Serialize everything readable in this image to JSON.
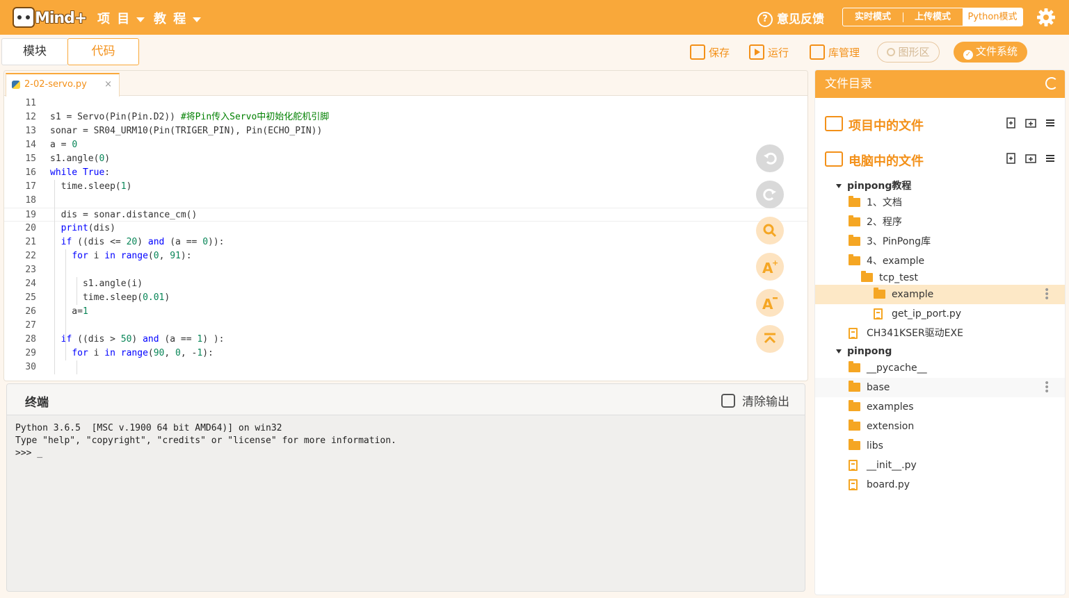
{
  "app": {
    "logo_text": "Mind+",
    "menu_project": "项 目",
    "menu_tutorial": "教 程",
    "feedback": "意见反馈",
    "modes": [
      "实时模式",
      "上传模式",
      "Python模式"
    ]
  },
  "subbar": {
    "tab_blocks": "模块",
    "tab_code": "代码",
    "save": "保存",
    "run": "运行",
    "library": "库管理",
    "graphics": "图形区",
    "filesystem": "文件系统"
  },
  "editor": {
    "file_tab": "2-02-servo.py",
    "close": "×"
  },
  "code_lines": [
    {
      "n": "11",
      "html": ""
    },
    {
      "n": "12",
      "html": "s1 = Servo(Pin(Pin.D2)) <span class='cm'>#将Pin传入Servo中初始化舵机引脚</span>"
    },
    {
      "n": "13",
      "html": "sonar = SR04_URM10(Pin(TRIGER_PIN), Pin(ECHO_PIN))"
    },
    {
      "n": "14",
      "html": "a = <span class='num'>0</span>"
    },
    {
      "n": "15",
      "html": "s1.angle(<span class='num'>0</span>)"
    },
    {
      "n": "16",
      "html": "<span class='kw'>while</span> <span class='kw'>True</span>:"
    },
    {
      "n": "17",
      "html": "  time.sleep(<span class='num'>1</span>)"
    },
    {
      "n": "18",
      "html": ""
    },
    {
      "n": "19",
      "html": "  dis = sonar.distance_cm()"
    },
    {
      "n": "20",
      "html": "  <span class='kw'>print</span>(dis)"
    },
    {
      "n": "21",
      "html": "  <span class='kw'>if</span> ((dis &lt;= <span class='num'>20</span>) <span class='kw'>and</span> (a == <span class='num'>0</span>)):"
    },
    {
      "n": "22",
      "html": "    <span class='kw'>for</span> i <span class='kw'>in</span> <span class='kw'>range</span>(<span class='num'>0</span>, <span class='num'>91</span>):"
    },
    {
      "n": "23",
      "html": ""
    },
    {
      "n": "24",
      "html": "      s1.angle(i)"
    },
    {
      "n": "25",
      "html": "      time.sleep(<span class='num'>0.01</span>)"
    },
    {
      "n": "26",
      "html": "    a=<span class='num'>1</span>"
    },
    {
      "n": "27",
      "html": ""
    },
    {
      "n": "28",
      "html": "  <span class='kw'>if</span> ((dis &gt; <span class='num'>50</span>) <span class='kw'>and</span> (a == <span class='num'>1</span>) ):"
    },
    {
      "n": "29",
      "html": "    <span class='kw'>for</span> i <span class='kw'>in</span> <span class='kw'>range</span>(<span class='num'>90</span>, <span class='num'>0</span>, -<span class='num'>1</span>):"
    },
    {
      "n": "30",
      "html": ""
    }
  ],
  "terminal": {
    "title": "终端",
    "clear": "清除输出",
    "output": "Python 3.6.5  [MSC v.1900 64 bit AMD64)] on win32\nType \"help\", \"copyright\", \"credits\" or \"license\" for more information.\n>>> _"
  },
  "files": {
    "header": "文件目录",
    "project_files": "项目中的文件",
    "pc_files": "电脑中的文件",
    "tree": [
      {
        "label": "pinpong教程",
        "type": "root"
      },
      {
        "label": "1、文档",
        "type": "folder"
      },
      {
        "label": "2、程序",
        "type": "folder"
      },
      {
        "label": "3、PinPong库",
        "type": "folder"
      },
      {
        "label": "4、example",
        "type": "folder-open"
      },
      {
        "label": "tcp_test",
        "type": "folder-open"
      },
      {
        "label": "example",
        "type": "folder"
      },
      {
        "label": "get_ip_port.py",
        "type": "file"
      },
      {
        "label": "CH341KSER驱动EXE",
        "type": "file"
      },
      {
        "label": "pinpong",
        "type": "root"
      },
      {
        "label": "__pycache__",
        "type": "folder"
      },
      {
        "label": "base",
        "type": "folder"
      },
      {
        "label": "examples",
        "type": "folder"
      },
      {
        "label": "extension",
        "type": "folder"
      },
      {
        "label": "libs",
        "type": "folder"
      },
      {
        "label": "__init__.py",
        "type": "file"
      },
      {
        "label": "board.py",
        "type": "file"
      }
    ]
  },
  "colors": {
    "accent": "#f9a83a",
    "accent_dark": "#f39018",
    "selected_row": "#fde8c6"
  }
}
